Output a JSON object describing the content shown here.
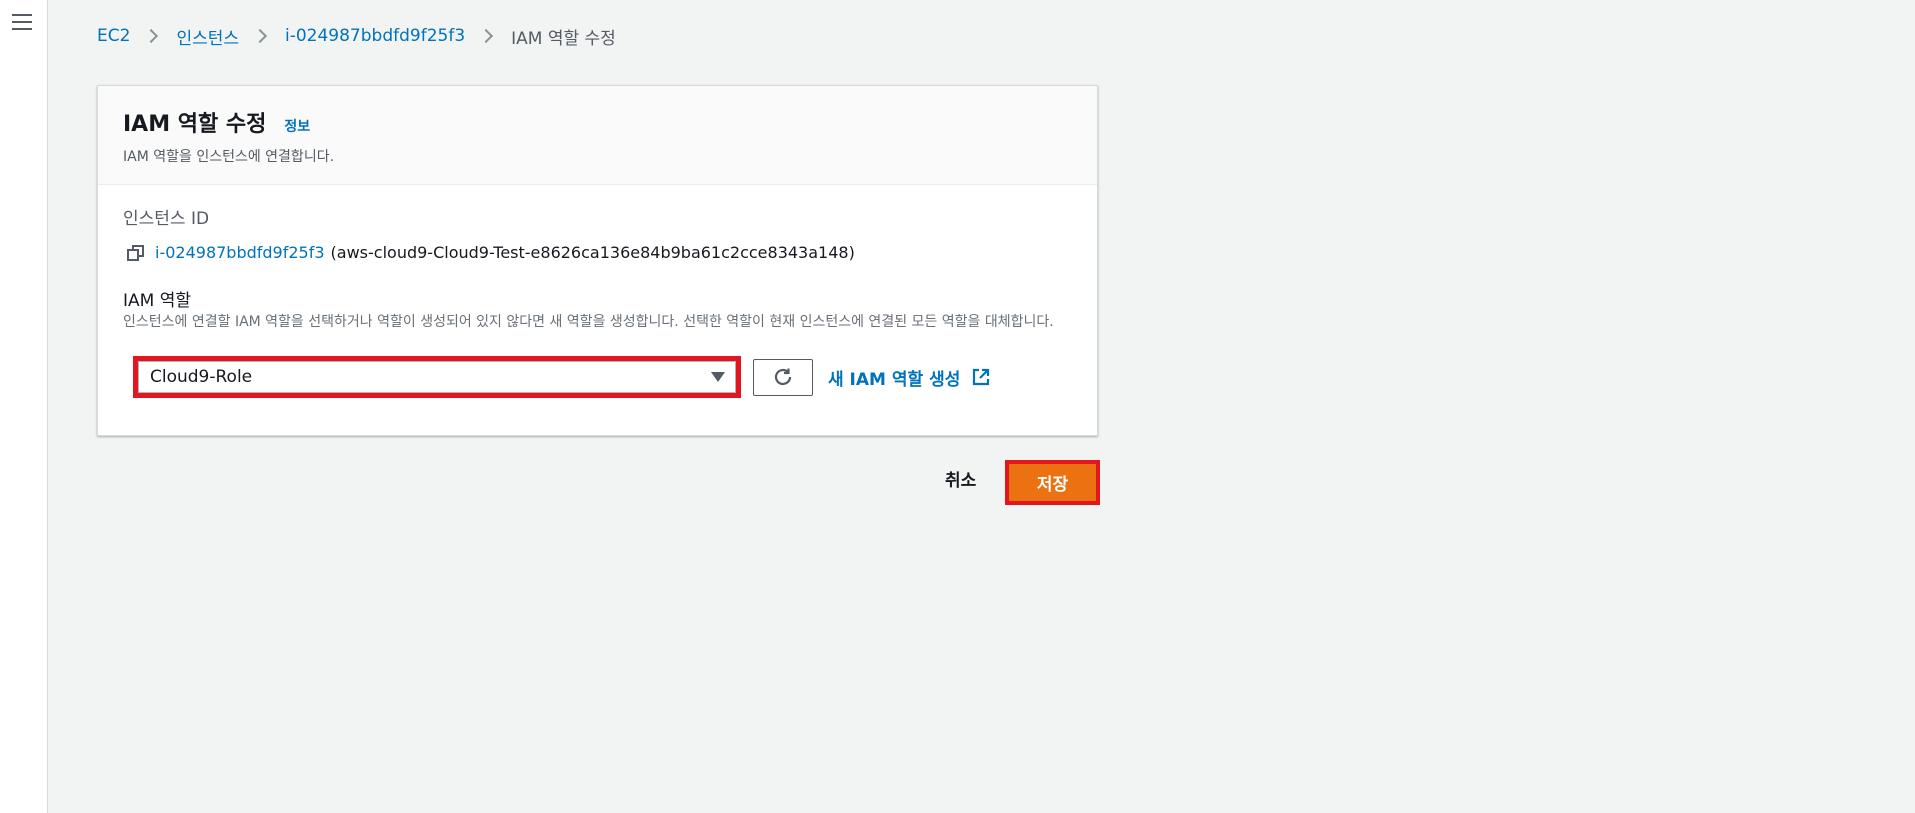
{
  "breadcrumb": {
    "items": [
      "EC2",
      "인스턴스",
      "i-024987bbdfd9f25f3"
    ],
    "current": "IAM 역할 수정"
  },
  "panel": {
    "title": "IAM 역할 수정",
    "info_link": "정보",
    "description": "IAM 역할을 인스턴스에 연결합니다.",
    "instance_id_label": "인스턴스 ID",
    "instance_id": "i-024987bbdfd9f25f3",
    "instance_name": "(aws-cloud9-Cloud9-Test-e8626ca136e84b9ba61c2cce8343a148)",
    "iam_role_label": "IAM 역할",
    "iam_role_description": "인스턴스에 연결할 IAM 역할을 선택하거나 역할이 생성되어 있지 않다면 새 역할을 생성합니다. 선택한 역할이 현재 인스턴스에 연결된 모든 역할을 대체합니다.",
    "selected_role": "Cloud9-Role",
    "create_role_link": "새 IAM 역할 생성"
  },
  "footer": {
    "cancel_label": "취소",
    "save_label": "저장"
  },
  "colors": {
    "link": "#0073bb",
    "primary_button": "#ec7211",
    "highlight": "#e3161f"
  },
  "icons": [
    "menu-icon",
    "chevron-right-icon",
    "copy-icon",
    "caret-down-icon",
    "refresh-icon",
    "external-link-icon"
  ]
}
